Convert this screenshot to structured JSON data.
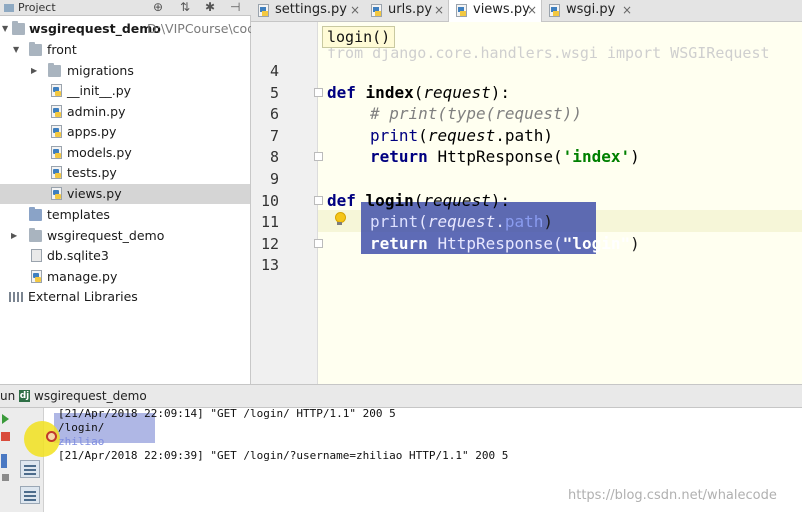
{
  "project_panel": {
    "title": "Project",
    "header_icons": [
      "⊕",
      "⇅",
      "✱",
      "⊣"
    ],
    "tree": [
      {
        "label": "wsgirequest_demo",
        "path": "D:\\VIPCourse\\cod",
        "icon": "project-folder-icon",
        "expanded": true,
        "bold": true
      },
      {
        "label": "front",
        "icon": "folder-icon",
        "expanded": true
      },
      {
        "label": "migrations",
        "icon": "folder-icon",
        "expanded": false
      },
      {
        "label": "__init__.py",
        "icon": "python-file-icon"
      },
      {
        "label": "admin.py",
        "icon": "python-file-icon"
      },
      {
        "label": "apps.py",
        "icon": "python-file-icon"
      },
      {
        "label": "models.py",
        "icon": "python-file-icon"
      },
      {
        "label": "tests.py",
        "icon": "python-file-icon"
      },
      {
        "label": "views.py",
        "icon": "python-file-icon",
        "selected": true
      },
      {
        "label": "templates",
        "icon": "templates-folder-icon"
      },
      {
        "label": "wsgirequest_demo",
        "icon": "folder-icon",
        "expanded": false
      },
      {
        "label": "db.sqlite3",
        "icon": "database-file-icon"
      },
      {
        "label": "manage.py",
        "icon": "python-file-icon"
      },
      {
        "label": "External Libraries",
        "icon": "external-libraries-icon"
      }
    ]
  },
  "editor": {
    "tabs": [
      {
        "label": "settings.py",
        "active": false
      },
      {
        "label": "urls.py",
        "active": false
      },
      {
        "label": "views.py",
        "active": true
      },
      {
        "label": "wsgi.py",
        "active": false
      }
    ],
    "tab_close_glyph": "×",
    "tooltip": "login()",
    "ghost_line": "from django.core.handlers.wsgi import WSGIRequest",
    "line_numbers": [
      "4",
      "5",
      "6",
      "7",
      "8",
      "9",
      "10",
      "11",
      "12",
      "13"
    ],
    "code": {
      "l5_kw": "def",
      "l5_fn": "index",
      "l5_open": "(",
      "l5_param": "request",
      "l5_close": "):",
      "l6_comment": "# print(type(request))",
      "l7_builtin": "print",
      "l7_open": "(",
      "l7_param": "request",
      "l7_rest": ".path)",
      "l8_kw": "return",
      "l8_call": "HttpResponse(",
      "l8_str": "'index'",
      "l8_close": ")",
      "l10_kw": "def",
      "l10_fn": "login",
      "l10_open": "(",
      "l10_param": "request",
      "l10_close": "):",
      "l11_builtin": "print",
      "l11_open": "(",
      "l11_param": "request",
      "l11_dot": ".",
      "l11_attr": "path",
      "l11_close": ")",
      "l12_kw": "return",
      "l12_call": "HttpResponse(",
      "l12_str": "\"login\"",
      "l12_close": ")"
    }
  },
  "run_panel": {
    "label": "un",
    "config_icon_letter": "dj",
    "config_name": "wsgirequest_demo",
    "console_lines": [
      "[21/Apr/2018 22:09:14] \"GET /login/ HTTP/1.1\" 200 5",
      "/login/",
      "zhiliao",
      "[21/Apr/2018 22:09:39] \"GET /login/?username=zhiliao HTTP/1.1\" 200 5"
    ]
  },
  "watermark": "https://blog.csdn.net/whalecode",
  "colors": {
    "keyword": "#000080",
    "string": "#008000",
    "comment": "#808080",
    "selection": "#2f3c9c",
    "editor_bg": "#fffff0"
  }
}
